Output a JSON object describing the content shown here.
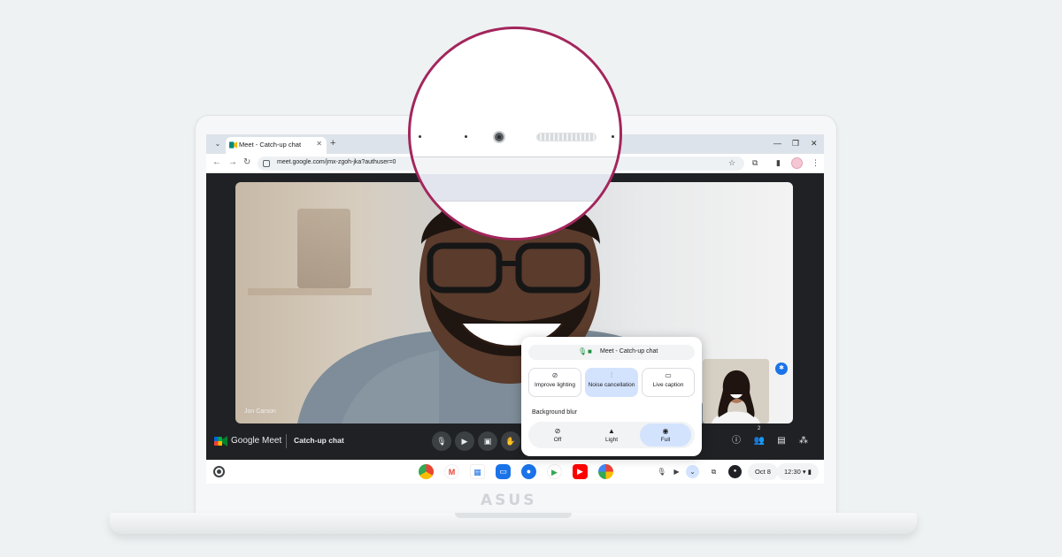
{
  "browser": {
    "tab_title": "Meet - Catch-up chat",
    "url": "meet.google.com/jmx-zgoh-jka?authuser=0"
  },
  "meet": {
    "brand": "Google Meet",
    "meeting_name": "Catch-up chat",
    "participant_name": "Jon Carson",
    "people_count": "2"
  },
  "quick_panel": {
    "title": "Meet - Catch-up chat",
    "effects": [
      {
        "label": "Improve lighting",
        "active": false
      },
      {
        "label": "Noise cancellation",
        "active": true
      },
      {
        "label": "Live caption",
        "active": false
      }
    ],
    "background_blur_label": "Background blur",
    "blur_options": [
      {
        "label": "Off",
        "active": false
      },
      {
        "label": "Light",
        "active": false
      },
      {
        "label": "Full",
        "active": true
      }
    ]
  },
  "shelf": {
    "date": "Oct 8",
    "time": "12:30"
  },
  "laptop": {
    "brand": "ASUS"
  },
  "colors": {
    "magnifier_ring": "#a3265c",
    "active_chip": "#d3e3fd",
    "meet_dark": "#202124"
  },
  "icons": [
    "search-icon",
    "mic-icon",
    "camera-icon",
    "hand-icon",
    "info-icon",
    "people-icon",
    "chat-icon",
    "activities-icon",
    "wifi-icon",
    "battery-icon"
  ]
}
